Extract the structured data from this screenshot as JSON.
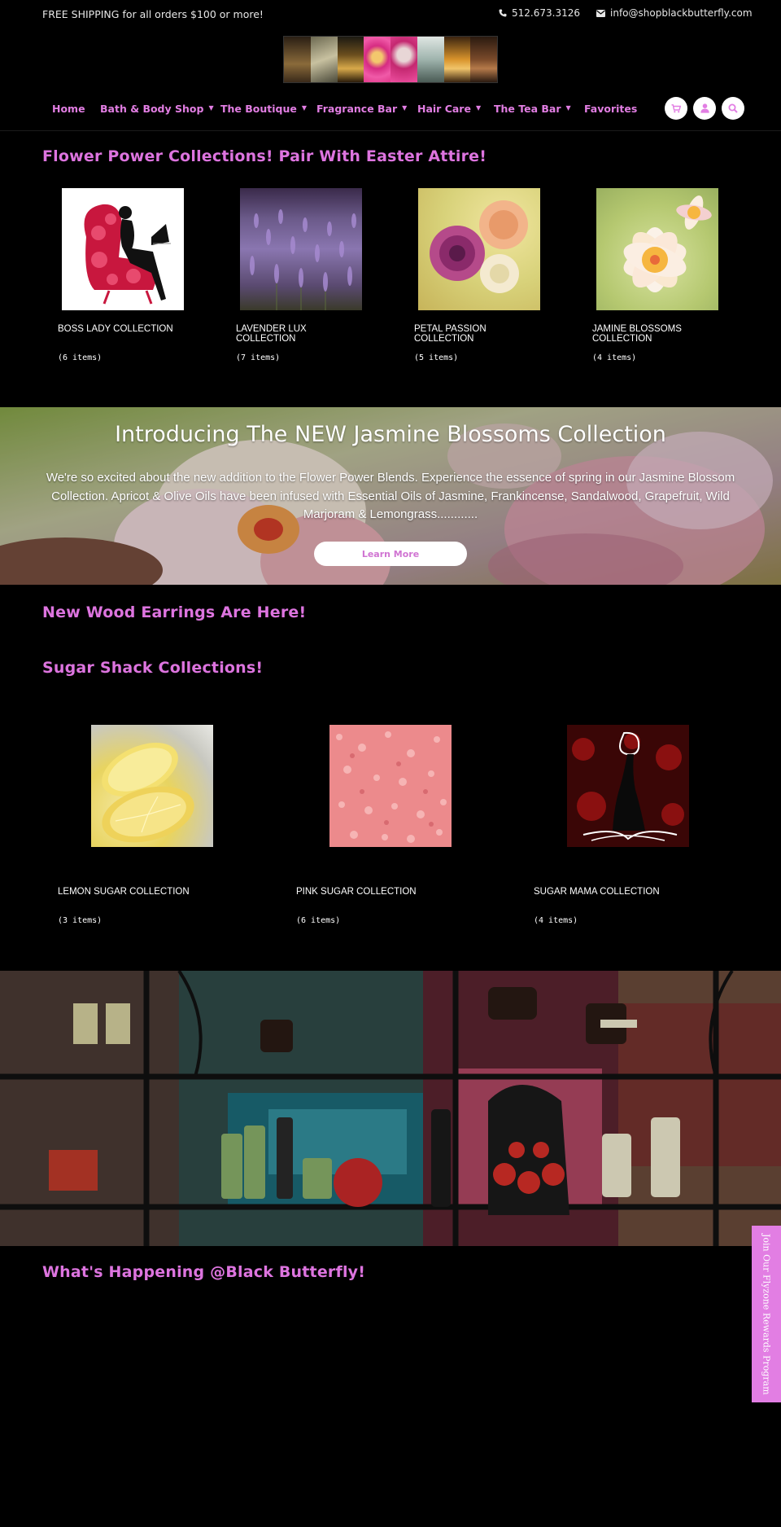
{
  "topbar": {
    "shipping": "FREE SHIPPING for all orders $100 or more!",
    "phone": "512.673.3126",
    "email": "info@shopblackbutterfly.com"
  },
  "nav": {
    "items": [
      {
        "label": "Home",
        "dropdown": false
      },
      {
        "label": "Bath & Body Shop",
        "dropdown": true
      },
      {
        "label": "The Boutique",
        "dropdown": true
      },
      {
        "label": "Fragrance Bar",
        "dropdown": true
      },
      {
        "label": "Hair Care",
        "dropdown": true
      },
      {
        "label": "The Tea Bar",
        "dropdown": true
      },
      {
        "label": "Favorites",
        "dropdown": false
      }
    ],
    "icons": [
      "cart-icon",
      "user-icon",
      "search-icon"
    ]
  },
  "flower": {
    "title": "Flower Power Collections! Pair With Easter Attire!",
    "collections": [
      {
        "title": "BOSS LADY COLLECTION",
        "count": "(6 items)"
      },
      {
        "title": "LAVENDER LUX COLLECTION",
        "count": "(7 items)"
      },
      {
        "title": "PETAL PASSION COLLECTION",
        "count": "(5 items)"
      },
      {
        "title": "JAMINE BLOSSOMS COLLECTION",
        "count": "(4 items)"
      }
    ]
  },
  "banner": {
    "heading": "Introducing The NEW Jasmine Blossoms Collection",
    "text": "We're so excited about the new addition to the Flower Power Blends. Experience the essence of spring in our Jasmine Blossom Collection. Apricot & Olive Oils have been infused with Essential Oils of Jasmine, Frankincense, Sandalwood, Grapefruit, Wild Marjoram & Lemongrass............",
    "button": "Learn More"
  },
  "earrings": {
    "title": "New Wood Earrings Are Here!"
  },
  "sugar": {
    "title": "Sugar Shack Collections!",
    "collections": [
      {
        "title": "LEMON SUGAR COLLECTION",
        "count": "(3 items)"
      },
      {
        "title": "PINK SUGAR COLLECTION",
        "count": "(6 items)"
      },
      {
        "title": "SUGAR MAMA COLLECTION",
        "count": "(4 items)"
      }
    ]
  },
  "happening": {
    "title": "What's Happening @Black Butterfly!"
  },
  "rewards": {
    "label": "Join Our Flyzone Rewards Program"
  },
  "colors": {
    "accent": "#e27ee3",
    "background": "#000000",
    "text": "#ffffff"
  }
}
